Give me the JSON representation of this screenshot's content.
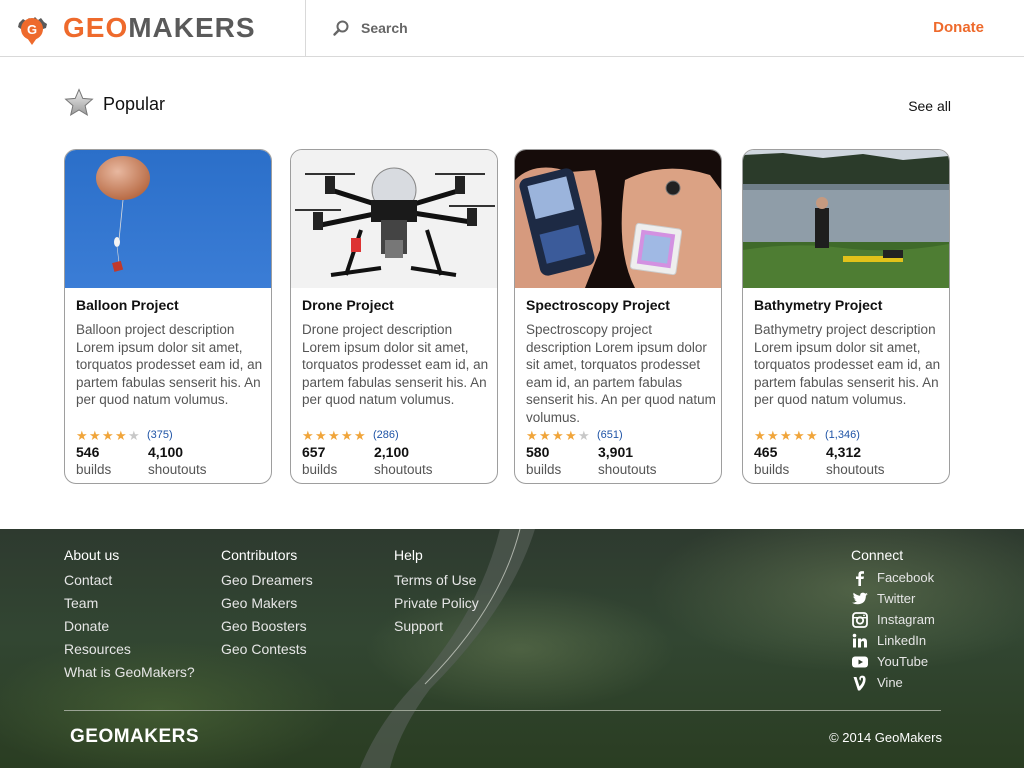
{
  "header": {
    "logo_geo": "GEO",
    "logo_makers": "MAKERS",
    "search_label": "Search",
    "donate_label": "Donate"
  },
  "popular": {
    "title": "Popular",
    "see_all": "See all"
  },
  "cards": [
    {
      "title": "Balloon Project",
      "description": "Balloon project description Lorem ipsum dolor sit amet, torquatos prodesset eam id, an partem fabulas senserit his. An per quod natum volumus.",
      "rating_stars": 4,
      "rating_count": "(375)",
      "builds": "546",
      "builds_label": "builds",
      "shoutouts": "4,100",
      "shoutouts_label": "shoutouts"
    },
    {
      "title": "Drone Project",
      "description": "Drone project description Lorem ipsum dolor sit amet, torquatos prodesset eam id, an partem fabulas senserit his. An per quod natum volumus.",
      "rating_stars": 5,
      "rating_count": "(286)",
      "builds": "657",
      "builds_label": "builds",
      "shoutouts": "2,100",
      "shoutouts_label": "shoutouts"
    },
    {
      "title": "Spectroscopy Project",
      "description": "Spectroscopy project description Lorem ipsum dolor sit amet, torquatos prodesset eam id, an partem fabulas senserit his. An per quod natum volumus.",
      "rating_stars": 4,
      "rating_count": "(651)",
      "builds": "580",
      "builds_label": "builds",
      "shoutouts": "3,901",
      "shoutouts_label": "shoutouts"
    },
    {
      "title": "Bathymetry Project",
      "description": "Bathymetry project description Lorem ipsum dolor sit amet, torquatos prodesset eam id, an partem fabulas senserit his. An per quod natum volumus.",
      "rating_stars": 5,
      "rating_count": "(1,346)",
      "builds": "465",
      "builds_label": "builds",
      "shoutouts": "4,312",
      "shoutouts_label": "shoutouts"
    }
  ],
  "footer": {
    "about": {
      "heading": "About us",
      "links": [
        "Contact",
        "Team",
        "Donate",
        "Resources",
        "What is GeoMakers?"
      ]
    },
    "contributors": {
      "heading": "Contributors",
      "links": [
        "Geo Dreamers",
        "Geo Makers",
        "Geo Boosters",
        "Geo Contests"
      ]
    },
    "help": {
      "heading": "Help",
      "links": [
        "Terms of Use",
        "Private Policy",
        "Support"
      ]
    },
    "connect": {
      "heading": "Connect",
      "links": [
        {
          "label": "Facebook",
          "icon": "facebook-icon"
        },
        {
          "label": "Twitter",
          "icon": "twitter-icon"
        },
        {
          "label": "Instagram",
          "icon": "instagram-icon"
        },
        {
          "label": "LinkedIn",
          "icon": "linkedin-icon"
        },
        {
          "label": "YouTube",
          "icon": "youtube-icon"
        },
        {
          "label": "Vine",
          "icon": "vine-icon"
        }
      ]
    },
    "logo_text": "GEOMAKERS",
    "copyright": "© 2014 GeoMakers"
  },
  "colors": {
    "brand_orange": "#ee6a2c",
    "logo_gray": "#5a5a5a",
    "star_gold": "#f0a53b",
    "rating_link": "#1f54a6"
  }
}
